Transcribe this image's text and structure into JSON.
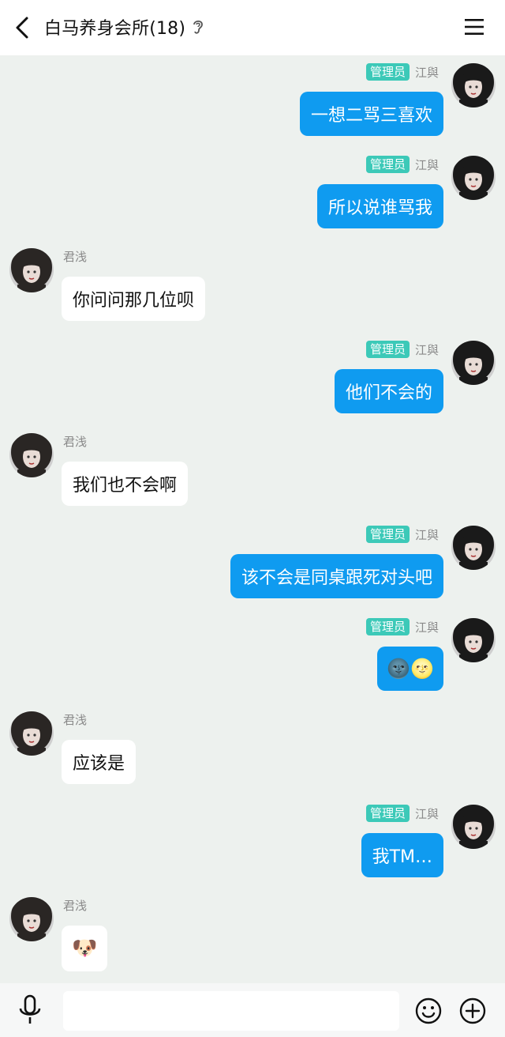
{
  "header": {
    "title": "白马养身会所(18)",
    "back_icon": "chevron-left-icon",
    "ear_icon": "ear-icon",
    "menu_icon": "hamburger-menu-icon"
  },
  "colors": {
    "self_bubble": "#0f9bf0",
    "other_bubble": "#ffffff",
    "admin_badge": "#3cc9b8",
    "background": "#edf1ee"
  },
  "messages": [
    {
      "side": "right",
      "badge": "管理员",
      "name": "江與",
      "text": "一想二骂三喜欢"
    },
    {
      "side": "right",
      "badge": "管理员",
      "name": "江與",
      "text": "所以说谁骂我"
    },
    {
      "side": "left",
      "name": "君浅",
      "text": "你问问那几位呗"
    },
    {
      "side": "right",
      "badge": "管理员",
      "name": "江與",
      "text": "他们不会的"
    },
    {
      "side": "left",
      "name": "君浅",
      "text": "我们也不会啊"
    },
    {
      "side": "right",
      "badge": "管理员",
      "name": "江與",
      "text": "该不会是同桌跟死对头吧"
    },
    {
      "side": "right",
      "badge": "管理员",
      "name": "江與",
      "text": "🌚🌝"
    },
    {
      "side": "left",
      "name": "君浅",
      "text": "应该是"
    },
    {
      "side": "right",
      "badge": "管理员",
      "name": "江與",
      "text": "我TM…"
    },
    {
      "side": "left",
      "name": "君浅",
      "text": "🐶"
    }
  ],
  "bottom_bar": {
    "mic_icon": "microphone-icon",
    "input_value": "",
    "emoji_icon": "smiley-icon",
    "plus_icon": "plus-circle-icon"
  }
}
